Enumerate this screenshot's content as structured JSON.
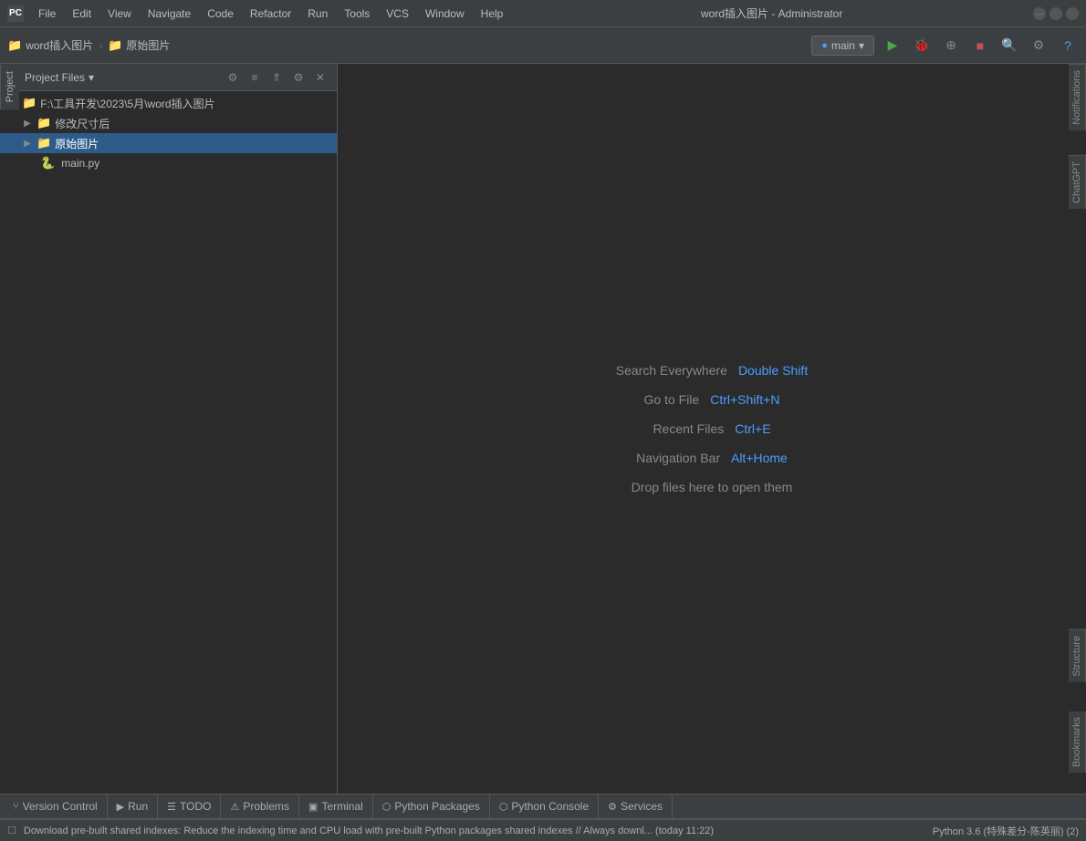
{
  "window": {
    "title": "word插入图片 - Administrator",
    "logo_text": "PC"
  },
  "menubar": {
    "items": [
      "File",
      "Edit",
      "View",
      "Navigate",
      "Code",
      "Refactor",
      "Run",
      "Tools",
      "VCS",
      "Window",
      "Help"
    ]
  },
  "toolbar": {
    "breadcrumb_project": "word插入图片",
    "breadcrumb_sep": "›",
    "breadcrumb_folder": "原始图片",
    "run_config_label": "main",
    "run_config_arrow": "▾"
  },
  "project_panel": {
    "title": "Project Files",
    "arrow": "▾",
    "root_path": "F:\\工具开发\\2023\\5月\\word插入图片",
    "tree": [
      {
        "id": "root",
        "label": "F:\\工具开发\\2023\\5月\\word插入图片",
        "type": "root",
        "indent": 0,
        "expanded": true
      },
      {
        "id": "xiugai",
        "label": "修改尺寸后",
        "type": "folder",
        "indent": 1,
        "expanded": false
      },
      {
        "id": "yuanshi",
        "label": "原始图片",
        "type": "folder",
        "indent": 1,
        "expanded": true,
        "selected": true
      },
      {
        "id": "mainpy",
        "label": "main.py",
        "type": "file_py",
        "indent": 2
      }
    ]
  },
  "editor": {
    "hint_search_label": "Search Everywhere",
    "hint_search_key": "Double Shift",
    "hint_goto_label": "Go to File",
    "hint_goto_key": "Ctrl+Shift+N",
    "hint_recent_label": "Recent Files",
    "hint_recent_key": "Ctrl+E",
    "hint_nav_label": "Navigation Bar",
    "hint_nav_key": "Alt+Home",
    "hint_drop": "Drop files here to open them"
  },
  "bottom_tabs": [
    {
      "id": "version-control",
      "icon": "⑂",
      "label": "Version Control"
    },
    {
      "id": "run",
      "icon": "▶",
      "label": "Run"
    },
    {
      "id": "todo",
      "icon": "☰",
      "label": "TODO"
    },
    {
      "id": "problems",
      "icon": "⚠",
      "label": "Problems"
    },
    {
      "id": "terminal",
      "icon": "▣",
      "label": "Terminal"
    },
    {
      "id": "python-packages",
      "icon": "⬡",
      "label": "Python Packages"
    },
    {
      "id": "python-console",
      "icon": "⬡",
      "label": "Python Console"
    },
    {
      "id": "services",
      "icon": "⚙",
      "label": "Services"
    }
  ],
  "status_bar": {
    "message": "Download pre-built shared indexes: Reduce the indexing time and CPU load with pre-built Python packages shared indexes // Always downl... (today 11:22)",
    "python_info": "Python 3.6 (特殊差分-陈英丽) (2)"
  },
  "side_labels": {
    "notifications": "Notifications",
    "chatgpt": "ChatGPT",
    "project": "Project",
    "structure": "Structure",
    "bookmarks": "Bookmarks"
  }
}
